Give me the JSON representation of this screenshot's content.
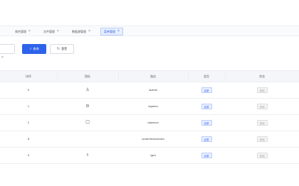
{
  "tabs": [
    {
      "label": "",
      "active": false
    },
    {
      "label": "角色管理",
      "active": false
    },
    {
      "label": "文件管理",
      "active": false
    },
    {
      "label": "数据源管理",
      "active": false
    },
    {
      "label": "菜单管理",
      "active": true
    }
  ],
  "toolbar": {
    "search_input_value": "",
    "search_label": "查询",
    "reset_label": "重置"
  },
  "table": {
    "columns": [
      "排序",
      "图标",
      "路由",
      "类型",
      "状态"
    ],
    "rows": [
      {
        "order": "0",
        "icon": "user-icon",
        "path": "/admin",
        "type": "目录",
        "status": "关闭"
      },
      {
        "order": "1",
        "icon": "gear-icon",
        "path": "/system",
        "type": "目录",
        "status": "关闭"
      },
      {
        "order": "2",
        "icon": "monitor-icon",
        "path": "/daemon",
        "type": "目录",
        "status": "关闭"
      },
      {
        "order": "8",
        "icon": "",
        "path": "/order/items/index",
        "type": "目录",
        "status": "关闭"
      },
      {
        "order": "9",
        "icon": "users-icon",
        "path": "/gen",
        "type": "目录",
        "status": "关闭"
      }
    ]
  },
  "colors": {
    "accent": "#2e62ea",
    "tag_blue": "#2f5fe8",
    "muted": "#999999"
  }
}
